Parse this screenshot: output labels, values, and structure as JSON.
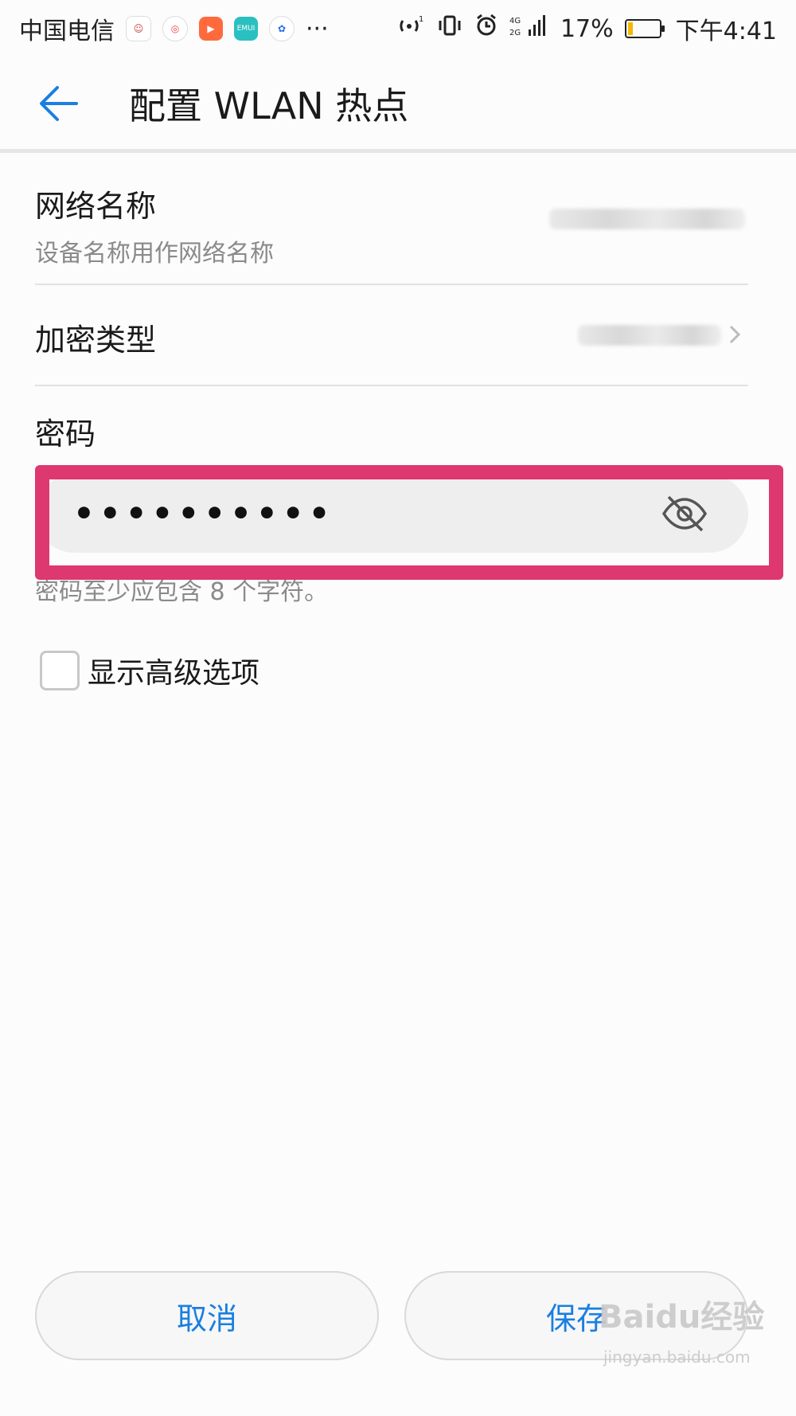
{
  "status_bar": {
    "carrier": "中国电信",
    "more": "···",
    "network": "4G 2G",
    "battery": "17%",
    "battery_level": 0.17,
    "time": "下午4:41",
    "ellipsis": "···"
  },
  "header": {
    "title": "配置 WLAN 热点"
  },
  "network_name": {
    "label": "网络名称",
    "sub": "设备名称用作网络名称"
  },
  "encryption": {
    "label": "加密类型"
  },
  "password": {
    "label": "密码",
    "value": "••••••••••",
    "hint": "密码至少应包含 8 个字符。"
  },
  "advanced": {
    "label": "显示高级选项",
    "checked": false
  },
  "buttons": {
    "cancel": "取消",
    "save": "保存"
  },
  "watermark": {
    "text": "Baidu经验",
    "sub": "jingyan.baidu.com"
  },
  "colors": {
    "accent": "#1a7fe0",
    "highlight": "#dd3870"
  }
}
